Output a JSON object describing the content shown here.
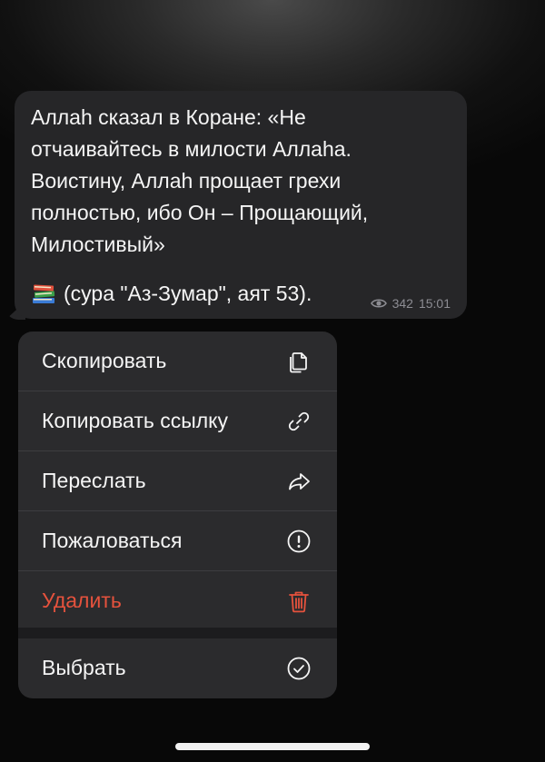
{
  "message": {
    "text": "Аллаh сказал в Коране: «Не\nотчаивайтесь в милости Аллаhа.\nВоистину, Аллаh прощает грехи\nполностью, ибо Он – Прощающий,\nМилостивый»",
    "source_icon": "books-icon",
    "source": "(сура \"Аз-Зумар\", аят 53).",
    "views": "342",
    "time": "15:01"
  },
  "menu": {
    "items": [
      {
        "label": "Скопировать",
        "icon": "copy-icon"
      },
      {
        "label": "Копировать ссылку",
        "icon": "link-icon"
      },
      {
        "label": "Переслать",
        "icon": "forward-icon"
      },
      {
        "label": "Пожаловаться",
        "icon": "report-icon"
      },
      {
        "label": "Удалить",
        "icon": "trash-icon",
        "color": "#e5523d"
      },
      {
        "label": "Выбрать",
        "icon": "select-check-icon"
      }
    ]
  }
}
